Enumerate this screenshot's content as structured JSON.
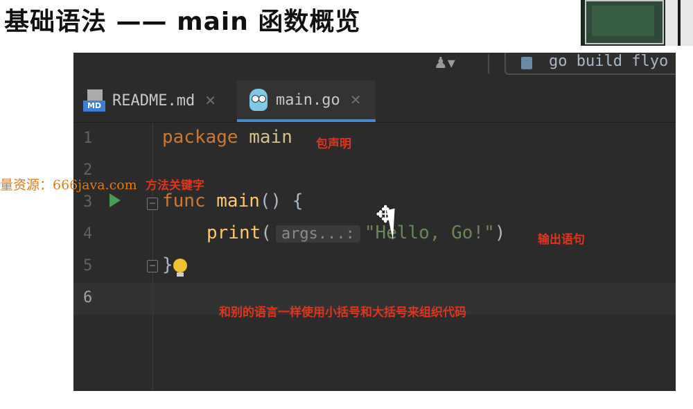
{
  "slide": {
    "title": "基础语法 —— main 函数概览"
  },
  "toolbar": {
    "user_icon": "user-dropdown-icon",
    "run_config_label": "go build flyo"
  },
  "tabs": [
    {
      "label": "README.md",
      "icon": "markdown-file-icon",
      "active": false
    },
    {
      "label": "main.go",
      "icon": "gopher-icon",
      "active": true
    }
  ],
  "editor": {
    "line_numbers": [
      "1",
      "2",
      "3",
      "4",
      "5",
      "6"
    ],
    "current_line": 6,
    "lines": {
      "l1_keyword": "package",
      "l1_name": "main",
      "l3_keyword": "func",
      "l3_name": "main",
      "l3_rest": "() {",
      "l4_fn": "print",
      "l4_open": "(",
      "l4_hint": "args...:",
      "l4_string": "\"Hello, Go!\"",
      "l4_close": ")",
      "l5_brace": "}"
    }
  },
  "annotations": {
    "package_decl": "包声明",
    "method_keyword": "方法关键字",
    "output_statement": "输出语句",
    "braces_note": "和别的语言一样使用小括号和大括号来组织代码"
  },
  "watermark": "量资源：666java.com",
  "colors": {
    "ide_bg": "#2b2b2b",
    "keyword": "#cc7832",
    "function": "#ffc66d",
    "string": "#6a8759",
    "annotation_red": "#e0341b",
    "tab_underline": "#4a88c7"
  }
}
